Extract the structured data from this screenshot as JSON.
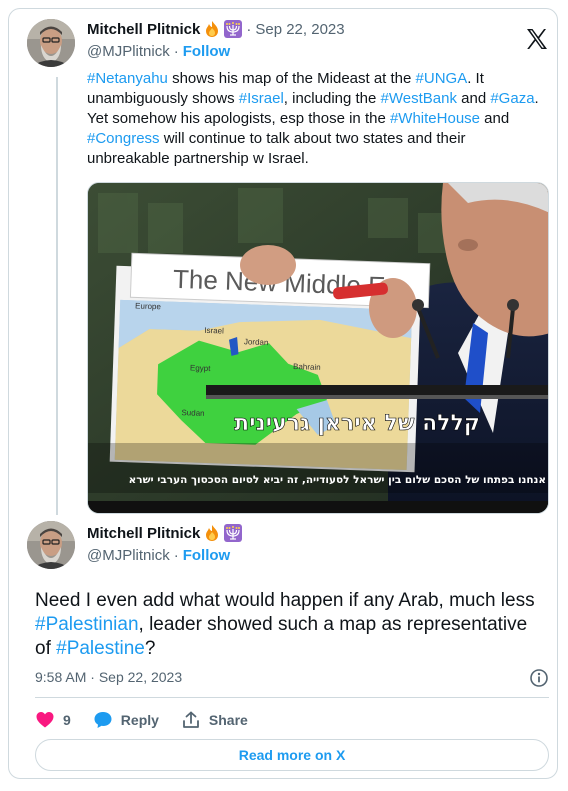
{
  "tweet1": {
    "author_name": "Mitchell Plitnick",
    "emoji_1": "fire-icon",
    "emoji_2": "menorah-icon",
    "date_sep": "·",
    "date": "Sep 22, 2023",
    "handle": "@MJPlitnick",
    "handle_sep": "·",
    "follow_label": "Follow",
    "text_segments": [
      {
        "type": "tag",
        "text": "#Netanyahu"
      },
      {
        "type": "text",
        "text": " shows his map of the Mideast at the "
      },
      {
        "type": "tag",
        "text": "#UNGA"
      },
      {
        "type": "text",
        "text": ". It unambiguously shows "
      },
      {
        "type": "tag",
        "text": "#Israel"
      },
      {
        "type": "text",
        "text": ", including the "
      },
      {
        "type": "tag",
        "text": "#WestBank"
      },
      {
        "type": "text",
        "text": " and "
      },
      {
        "type": "tag",
        "text": "#Gaza"
      },
      {
        "type": "text",
        "text": ". Yet somehow his apologists, esp those in the "
      },
      {
        "type": "tag",
        "text": "#WhiteHouse"
      },
      {
        "type": "text",
        "text": " and "
      },
      {
        "type": "tag",
        "text": "#Congress"
      },
      {
        "type": "text",
        "text": " will continue to talk about two states and their unbreakable partnership w Israel."
      }
    ],
    "media": {
      "sign_text": "The New Middle E",
      "map_labels": {
        "europe": "Europe",
        "israel": "Israel",
        "jordan": "Jordan",
        "egypt": "Egypt",
        "bahrain": "Bahrain",
        "sudan": "Sudan"
      },
      "caption_main": "קללה של איראן גרעינית",
      "caption_sub": "אנחנו בפתחו של הסכם שלום בין ישראל לסעודייה, זה יביא לסיום הסכסוך הערבי ישרא"
    }
  },
  "tweet2": {
    "author_name": "Mitchell Plitnick",
    "emoji_1": "fire-icon",
    "emoji_2": "menorah-icon",
    "handle": "@MJPlitnick",
    "handle_sep": "·",
    "follow_label": "Follow",
    "text_segments": [
      {
        "type": "text",
        "text": "Need I even add what would happen if any Arab, much less "
      },
      {
        "type": "tag",
        "text": "#Palestinian"
      },
      {
        "type": "text",
        "text": ", leader showed such a map as representative of "
      },
      {
        "type": "tag",
        "text": "#Palestine"
      },
      {
        "type": "text",
        "text": "?"
      }
    ],
    "time": "9:58 AM",
    "meta_sep": "·",
    "date": "Sep 22, 2023"
  },
  "actions": {
    "like_count": "9",
    "reply_label": "Reply",
    "share_label": "Share"
  },
  "read_more_label": "Read more on X",
  "colors": {
    "accent": "#1d9bf0",
    "like": "#f91880",
    "text": "#0f1419",
    "muted": "#536471",
    "border": "#cfd9de"
  }
}
